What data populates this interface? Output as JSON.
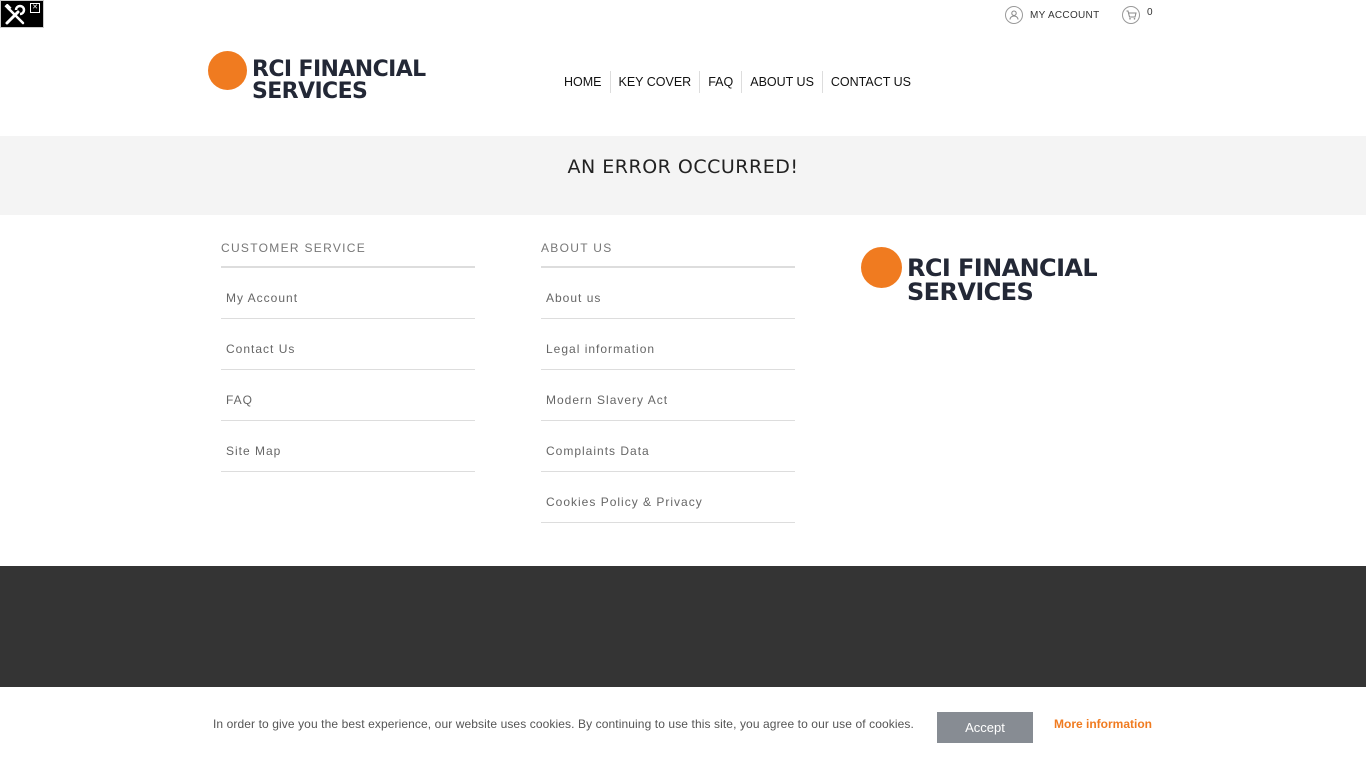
{
  "header": {
    "my_account": "MY ACCOUNT",
    "cart_count": "0",
    "logo": {
      "line1": "RCI FINANCIAL",
      "line2": "SERVICES"
    },
    "nav": [
      "HOME",
      "KEY COVER",
      "FAQ",
      "ABOUT US",
      "CONTACT US"
    ]
  },
  "error": {
    "title": "AN ERROR OCCURRED!"
  },
  "footer": {
    "customer_service": {
      "title": "CUSTOMER SERVICE",
      "links": [
        "My Account",
        "Contact Us",
        "FAQ",
        "Site Map"
      ]
    },
    "about_us": {
      "title": "ABOUT US",
      "links": [
        "About us",
        "Legal information",
        "Modern Slavery Act",
        "Complaints Data",
        "Cookies Policy & Privacy"
      ]
    },
    "logo": {
      "line1": "RCI FINANCIAL",
      "line2": "SERVICES"
    }
  },
  "cookie": {
    "text": "In order to give you the best experience, our website uses cookies. By continuing to use this site, you agree to our use of cookies.",
    "accept": "Accept",
    "more": "More information"
  },
  "colors": {
    "brand_orange": "#f07b20",
    "brand_navy": "#232836",
    "dark_band": "#343434",
    "error_band": "#f4f4f4",
    "accept_button": "#878c93"
  },
  "icons": [
    "tools-icon",
    "close-icon",
    "user-icon",
    "cart-icon"
  ]
}
